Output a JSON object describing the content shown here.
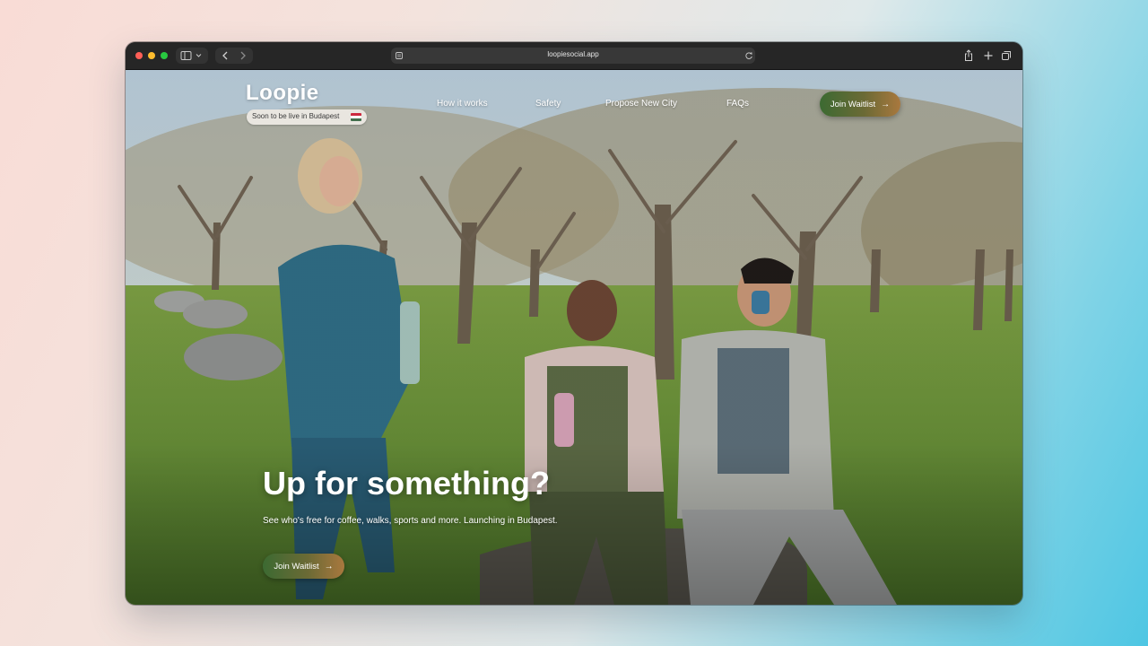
{
  "browser": {
    "url": "loopiesocial.app"
  },
  "brand": {
    "logo_text": "Loopie",
    "badge_text": "Soon to be live in Budapest",
    "flag_colors": [
      "#cd2a3e",
      "#ffffff",
      "#436f4d"
    ]
  },
  "nav": {
    "links": [
      "How it works",
      "Safety",
      "Propose New City",
      "FAQs"
    ],
    "cta_label": "Join Waitlist"
  },
  "hero": {
    "title": "Up for something?",
    "subtitle": "See who's free for coffee, walks, sports and more. Launching in Budapest.",
    "cta_label": "Join Waitlist",
    "image": "three-friends-sitting-on-rocks-in-orchard-park-photo"
  },
  "colors": {
    "cta_gradient_start": "#3c6a32",
    "cta_gradient_end": "#a9783e"
  }
}
